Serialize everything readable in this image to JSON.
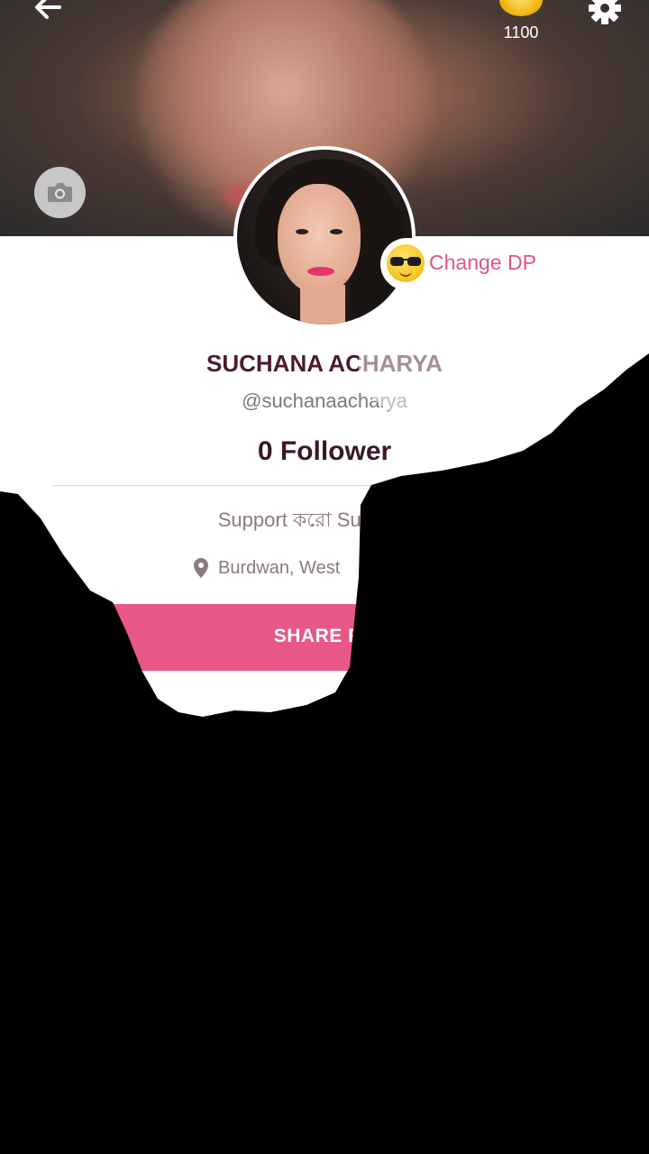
{
  "header": {
    "coins": "1100",
    "icons": [
      "back-arrow-icon",
      "coin-icon",
      "gear-icon",
      "camera-icon"
    ]
  },
  "profile": {
    "change_dp_label": "Change DP",
    "name": "SUCHANA ACHARYA",
    "handle": "@suchanaacharya",
    "followers": "0 Follower",
    "bio": "Support করো Support পা",
    "location": "Burdwan, West",
    "share_button": "SHARE PR"
  },
  "colors": {
    "accent": "#e8578a",
    "name_text": "#4a1f28",
    "change_dp_text": "#e2547f"
  }
}
